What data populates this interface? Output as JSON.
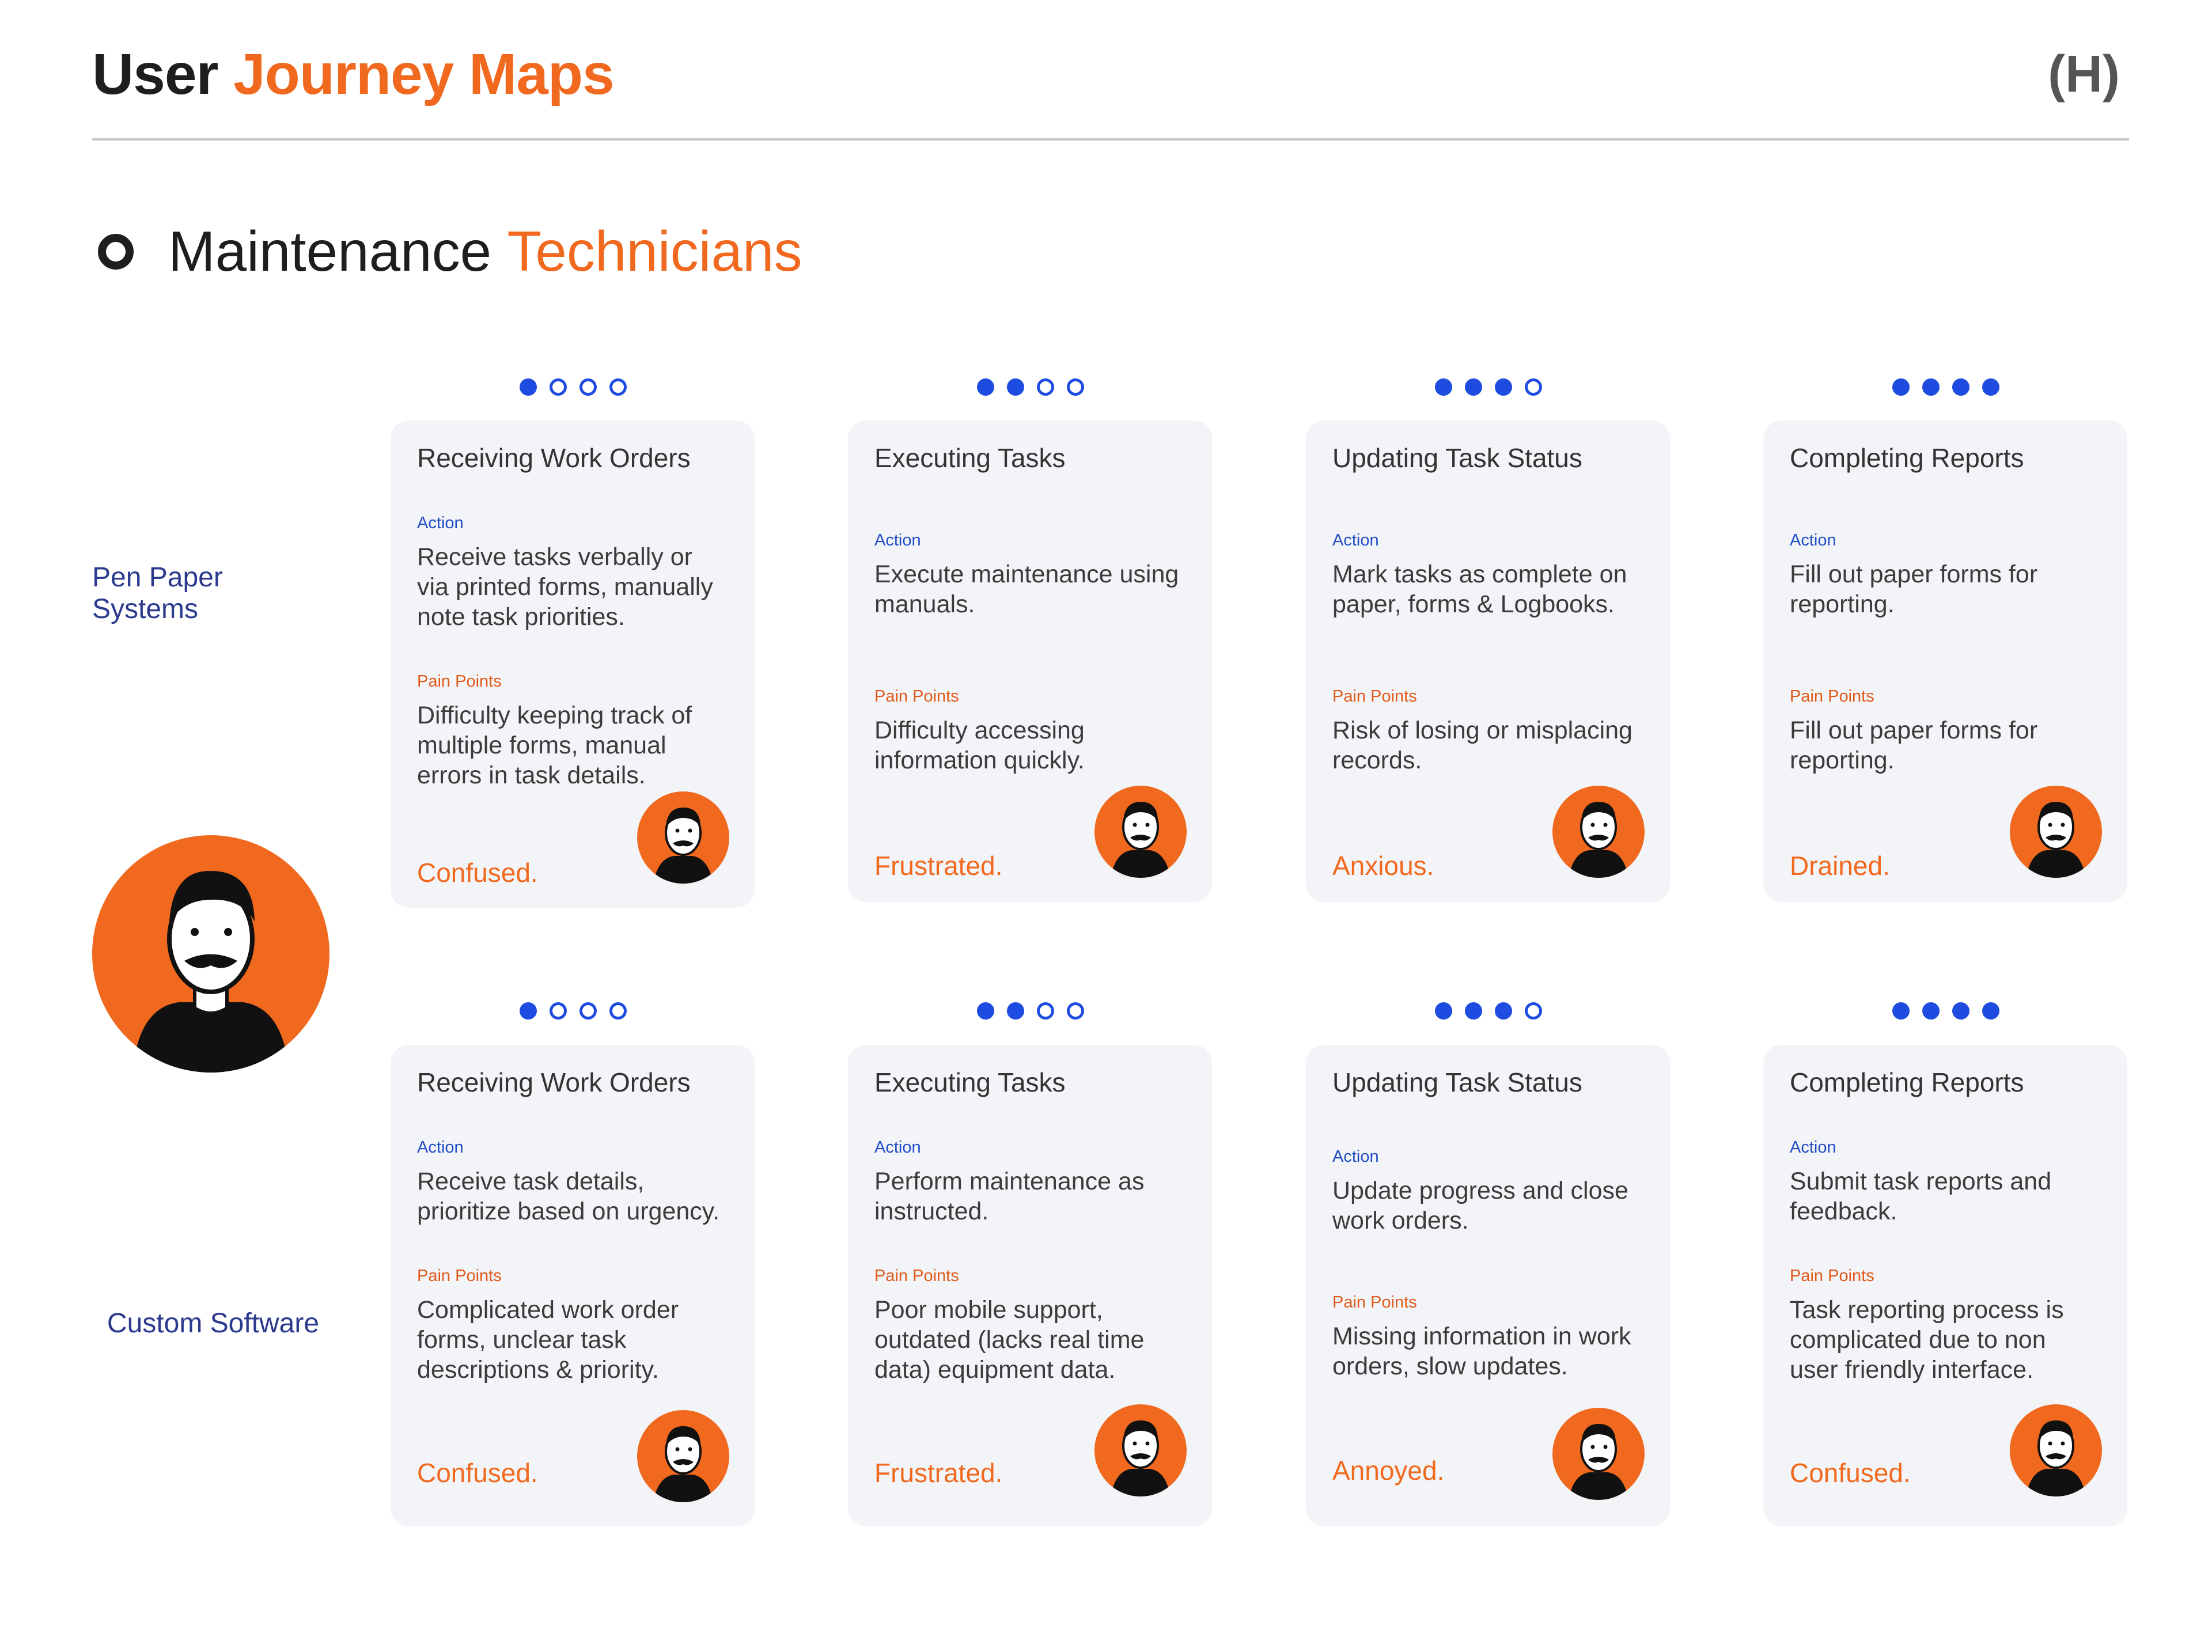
{
  "header": {
    "title_plain": "User",
    "title_accent": "Journey Maps",
    "code": "(H)"
  },
  "section": {
    "title_plain": "Maintenance",
    "title_accent": "Technicians"
  },
  "rows": [
    {
      "label": "Pen Paper Systems",
      "cards": [
        {
          "progress": 1,
          "total": 4,
          "title": "Receiving Work Orders",
          "action_label": "Action",
          "action": "Receive tasks verbally or via printed forms, manually note task priorities.",
          "pain_label": "Pain Points",
          "pain": "Difficulty keeping track of multiple forms, manual errors in task details.",
          "emotion": "Confused."
        },
        {
          "progress": 2,
          "total": 4,
          "title": "Executing Tasks",
          "action_label": "Action",
          "action": "Execute maintenance using manuals.",
          "pain_label": "Pain Points",
          "pain": "Difficulty accessing information quickly.",
          "emotion": "Frustrated."
        },
        {
          "progress": 3,
          "total": 4,
          "title": "Updating Task Status",
          "action_label": "Action",
          "action": "Mark tasks as complete on paper, forms & Logbooks.",
          "pain_label": "Pain Points",
          "pain": "Risk of losing or misplacing records.",
          "emotion": "Anxious."
        },
        {
          "progress": 4,
          "total": 4,
          "title": "Completing Reports",
          "action_label": "Action",
          "action": "Fill out paper forms for reporting.",
          "pain_label": "Pain Points",
          "pain": "Fill out paper forms for reporting.",
          "emotion": "Drained."
        }
      ]
    },
    {
      "label": "Custom Software",
      "cards": [
        {
          "progress": 1,
          "total": 4,
          "title": "Receiving Work Orders",
          "action_label": "Action",
          "action": "Receive task details, prioritize based on urgency.",
          "pain_label": "Pain Points",
          "pain": "Complicated work order forms, unclear task descriptions & priority.",
          "emotion": "Confused."
        },
        {
          "progress": 2,
          "total": 4,
          "title": "Executing Tasks",
          "action_label": "Action",
          "action": "Perform maintenance as instructed.",
          "pain_label": "Pain Points",
          "pain": "Poor mobile support, outdated (lacks real time data) equipment data.",
          "emotion": "Frustrated."
        },
        {
          "progress": 3,
          "total": 4,
          "title": "Updating Task Status",
          "action_label": "Action",
          "action": "Update progress and close work orders.",
          "pain_label": "Pain Points",
          "pain": "Missing information in work orders, slow updates.",
          "emotion": "Annoyed."
        },
        {
          "progress": 4,
          "total": 4,
          "title": "Completing Reports",
          "action_label": "Action",
          "action": "Submit task reports and feedback.",
          "pain_label": "Pain Points",
          "pain": "Task reporting process is complicated due to non user friendly interface.",
          "emotion": "Confused."
        }
      ]
    }
  ],
  "icons": {
    "persona": "technician-avatar-icon",
    "avatar": "technician-face-icon",
    "progress": "progress-dot-icon"
  },
  "colors": {
    "accent": "#f0691f",
    "blue": "#1f4ce0",
    "row_label": "#2c3a8e",
    "card_bg": "#f3f4f7"
  }
}
